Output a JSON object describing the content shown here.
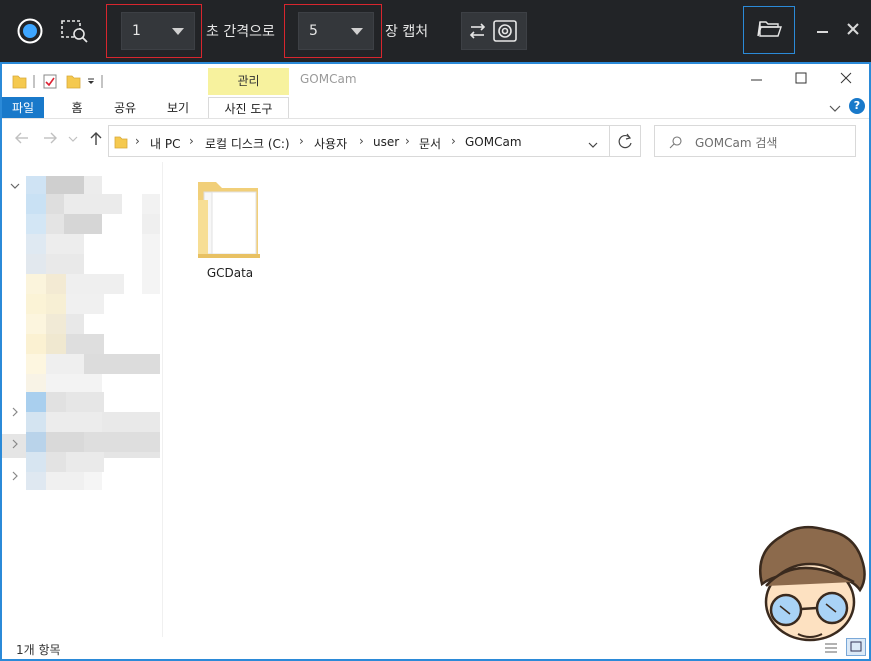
{
  "toolbar": {
    "interval_value": "1",
    "interval_label": "초 간격으로",
    "count_value": "5",
    "count_label": "장 캡처"
  },
  "window": {
    "ribbon_context_group": "관리",
    "title": "GOMCam",
    "tabs": [
      {
        "label": "파일",
        "active": true
      },
      {
        "label": "홈"
      },
      {
        "label": "공유"
      },
      {
        "label": "보기"
      },
      {
        "label": "사진 도구"
      }
    ]
  },
  "address": {
    "crumbs": [
      "내 PC",
      "로컬 디스크 (C:)",
      "사용자",
      "user",
      "문서",
      "GOMCam"
    ]
  },
  "search": {
    "placeholder": "GOMCam 검색"
  },
  "content": {
    "items": [
      {
        "name": "GCData",
        "type": "folder"
      }
    ]
  },
  "statusbar": {
    "item_count": "1개 항목"
  },
  "colors": {
    "toolbar_bg": "#222427",
    "highlight_red": "#d8262e",
    "highlight_blue": "#2b8ad8",
    "file_tab_blue": "#1979ca",
    "manage_yellow": "#f7f29e"
  }
}
